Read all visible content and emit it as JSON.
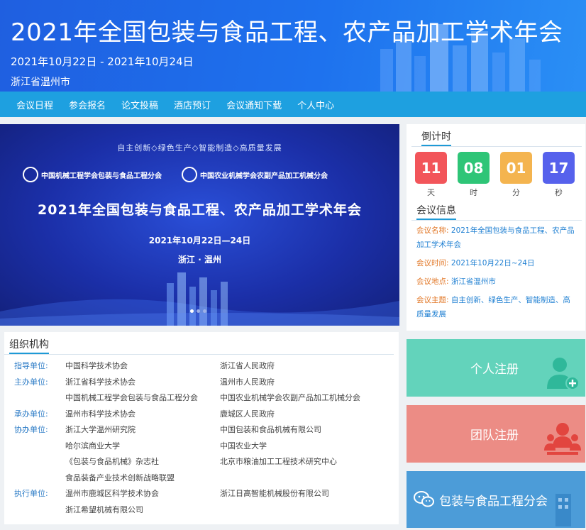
{
  "header": {
    "title": "2021年全国包装与食品工程、农产品加工学术年会",
    "date": "2021年10月22日 - 2021年10月24日",
    "place": "浙江省温州市"
  },
  "nav": [
    "会议日程",
    "参会报名",
    "论文投稿",
    "酒店预订",
    "会议通知下载",
    "个人中心"
  ],
  "banner": {
    "slogan": "自主创新◇绿色生产◇智能制造◇高质量发展",
    "org1": "中国机械工程学会包装与食品工程分会",
    "org2": "中国农业机械学会农副产品加工机械分会",
    "title": "2021年全国包装与食品工程、农产品加工学术年会",
    "date": "2021年10月22日—24日",
    "place": "浙江 · 温州",
    "slide_index": 1,
    "slide_count": 3
  },
  "countdown": {
    "title": "倒计时",
    "items": [
      {
        "value": "11",
        "unit": "天",
        "color": "#f2555a"
      },
      {
        "value": "08",
        "unit": "时",
        "color": "#2ec577"
      },
      {
        "value": "01",
        "unit": "分",
        "color": "#f4b44f"
      },
      {
        "value": "17",
        "unit": "秒",
        "color": "#5661ec"
      }
    ]
  },
  "info": {
    "title": "会议信息",
    "rows": [
      {
        "k": "会议名称:",
        "v": "2021年全国包装与食品工程、农产品加工学术年会"
      },
      {
        "k": "会议时间:",
        "v": "2021年10月22日~24日"
      },
      {
        "k": "会议地点:",
        "v": "浙江省温州市"
      },
      {
        "k": "会议主题:",
        "v": "自主创新、绿色生产、智能制造、高质量发展"
      }
    ]
  },
  "org": {
    "title": "组织机构",
    "rows": [
      {
        "label": "指导单位:",
        "c1": "中国科学技术协会",
        "c2": "浙江省人民政府"
      },
      {
        "label": "主办单位:",
        "c1": "浙江省科学技术协会",
        "c2": "温州市人民政府"
      },
      {
        "label": "",
        "c1": "中国机械工程学会包装与食品工程分会",
        "c2": "中国农业机械学会农副产品加工机械分会"
      },
      {
        "label": "承办单位:",
        "c1": "温州市科学技术协会",
        "c2": "鹿城区人民政府"
      },
      {
        "label": "协办单位:",
        "c1": "浙江大学温州研究院",
        "c2": "中国包装和食品机械有限公司"
      },
      {
        "label": "",
        "c1": "哈尔滨商业大学",
        "c2": "中国农业大学"
      },
      {
        "label": "",
        "c1": "《包装与食品机械》杂志社",
        "c2": "北京市粮油加工工程技术研究中心"
      },
      {
        "label": "",
        "c1": "食品装备产业技术创新战略联盟",
        "c2": ""
      },
      {
        "label": "执行单位:",
        "c1": "温州市鹿城区科学技术协会",
        "c2": "浙江日高智能机械股份有限公司"
      },
      {
        "label": "",
        "c1": "浙江希望机械有限公司",
        "c2": ""
      }
    ]
  },
  "buttons": {
    "personal": "个人注册",
    "team": "团队注册",
    "wechat": "包装与食品工程分会"
  }
}
